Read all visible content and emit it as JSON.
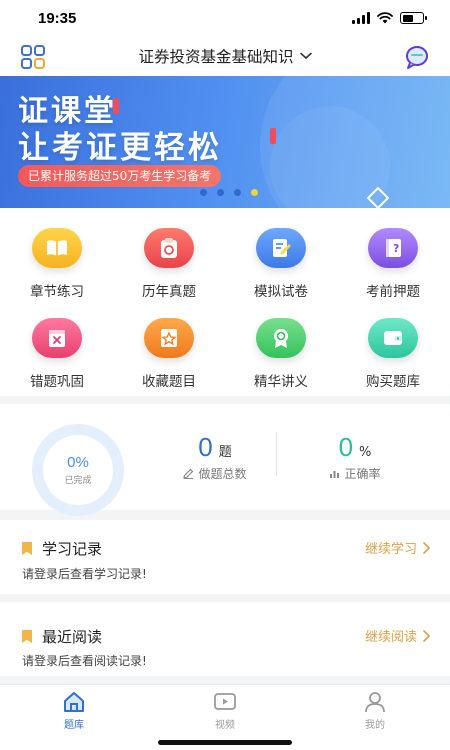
{
  "status_bar": {
    "time": "19:35"
  },
  "nav": {
    "title": "证券投资基金基础知识"
  },
  "banner": {
    "line1": "证课堂",
    "line2": "让考证更轻松",
    "tag": "已累计服务超过50万考生学习备考",
    "dot_count": 4,
    "active_dot": 3
  },
  "grid": {
    "items": [
      {
        "label": "章节练习",
        "icon": "book-icon",
        "color": "#f5c02f"
      },
      {
        "label": "历年真题",
        "icon": "clipboard-icon",
        "color": "#ef5a5a"
      },
      {
        "label": "模拟试卷",
        "icon": "exam-paper-icon",
        "color": "#4f8ef0"
      },
      {
        "label": "考前押题",
        "icon": "question-book-icon",
        "color": "#8d5ae8"
      },
      {
        "label": "错题巩固",
        "icon": "wrong-book-icon",
        "color": "#ef4f7d"
      },
      {
        "label": "收藏题目",
        "icon": "star-icon",
        "color": "#f28a2e"
      },
      {
        "label": "精华讲义",
        "icon": "medal-icon",
        "color": "#4ccf6a"
      },
      {
        "label": "购买题库",
        "icon": "wallet-icon",
        "color": "#3fd3b0"
      }
    ]
  },
  "stats": {
    "completion": "0%",
    "completion_value": 0,
    "completion_label": "已完成",
    "done_count": "0",
    "done_unit": "题",
    "done_label": "做题总数",
    "accuracy": "0",
    "accuracy_unit": "%",
    "accuracy_label": "正确率"
  },
  "study_record": {
    "title": "学习记录",
    "link": "继续学习",
    "note": "请登录后查看学习记录!"
  },
  "recent_reading": {
    "title": "最近阅读",
    "link": "继续阅读",
    "note": "请登录后查看阅读记录!"
  },
  "tabs": [
    {
      "label": "题库",
      "icon": "home-icon",
      "active": true
    },
    {
      "label": "视频",
      "icon": "video-icon",
      "active": false
    },
    {
      "label": "我的",
      "icon": "user-icon",
      "active": false
    }
  ],
  "colors": {
    "accent": "#4f8ef0",
    "link": "#d9a24a",
    "done_num": "#2f6fd8",
    "accuracy_num": "#2dbf9a",
    "tab_active": "#2f6fd8",
    "tab_inactive": "#9a9a9a"
  }
}
